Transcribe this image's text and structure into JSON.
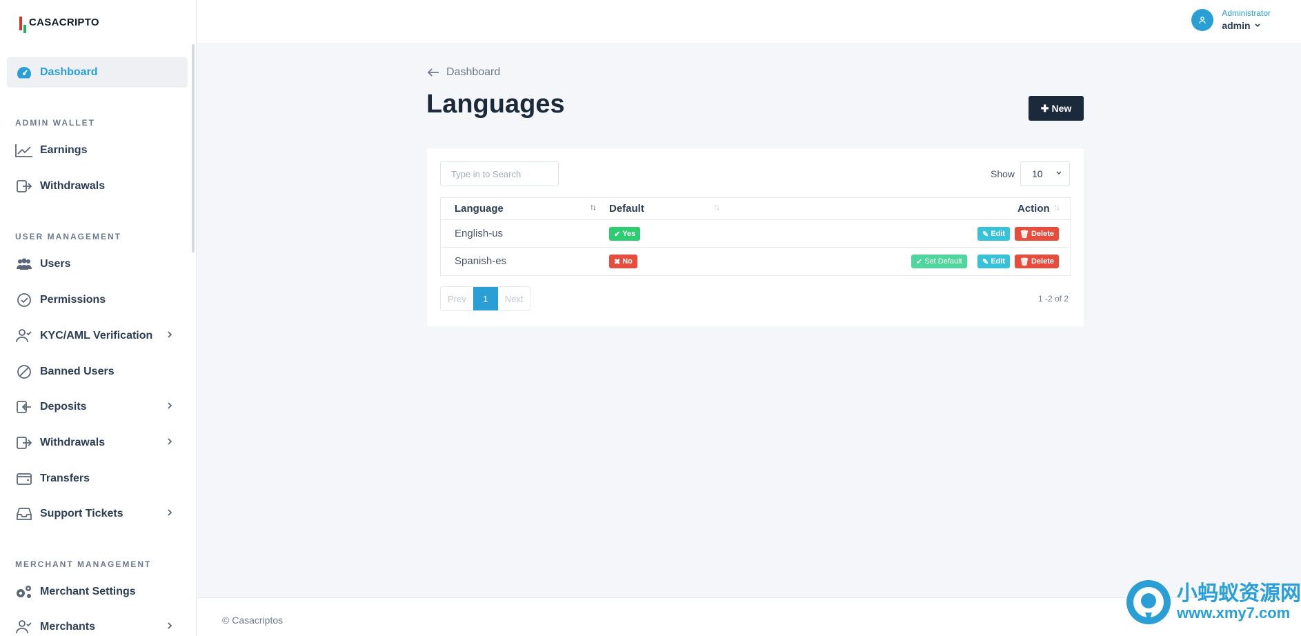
{
  "brand": {
    "name": "CASACRIPTO"
  },
  "sidebar": {
    "dashboard": "Dashboard",
    "sections": [
      {
        "label": "ADMIN WALLET"
      },
      {
        "label": "USER MANAGEMENT"
      },
      {
        "label": "MERCHANT MANAGEMENT"
      }
    ],
    "items": [
      {
        "label": "Earnings"
      },
      {
        "label": "Withdrawals"
      },
      {
        "label": "Users"
      },
      {
        "label": "Permissions"
      },
      {
        "label": "KYC/AML Verification"
      },
      {
        "label": "Banned Users"
      },
      {
        "label": "Deposits"
      },
      {
        "label": "Withdrawals"
      },
      {
        "label": "Transfers"
      },
      {
        "label": "Support Tickets"
      },
      {
        "label": "Merchant Settings"
      },
      {
        "label": "Merchants"
      }
    ]
  },
  "header": {
    "role": "Administrator",
    "username": "admin"
  },
  "breadcrumb": {
    "back": "Dashboard"
  },
  "page": {
    "title": "Languages",
    "new_label": "New"
  },
  "toolbar": {
    "search_placeholder": "Type in to Search",
    "show_label": "Show",
    "show_value": "10"
  },
  "table": {
    "columns": [
      "Language",
      "Default",
      "Action"
    ],
    "rows": [
      {
        "language": "English-us",
        "default": "Yes",
        "actions": [
          "Edit",
          "Delete"
        ]
      },
      {
        "language": "Spanish-es",
        "default": "No",
        "actions": [
          "Set Default",
          "Edit",
          "Delete"
        ]
      }
    ]
  },
  "pagination": {
    "prev": "Prev",
    "current": "1",
    "next": "Next",
    "range": "1 -2 of 2"
  },
  "footer": {
    "copyright": "© Casacriptos"
  },
  "watermark": {
    "line1": "小蚂蚁资源网",
    "line2": "www.xmy7.com"
  },
  "colors": {
    "accent": "#2a9fd6",
    "dark": "#1b2a3b",
    "success": "#2ecc71",
    "danger": "#e74c3c",
    "info": "#36c2d9"
  }
}
